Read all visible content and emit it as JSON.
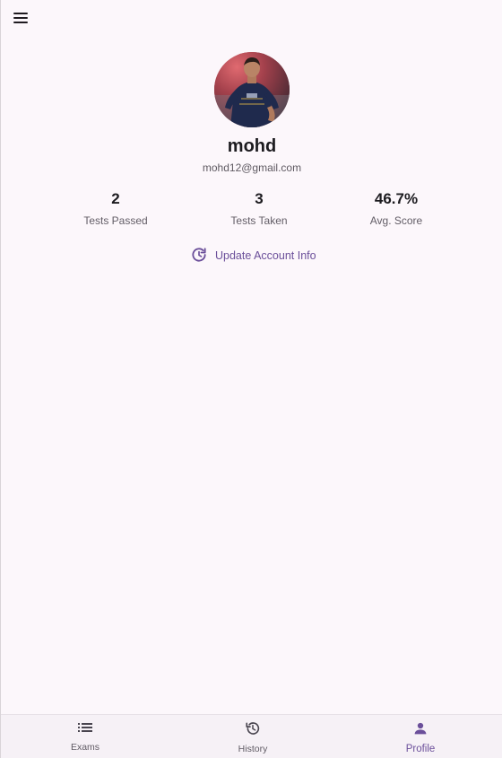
{
  "profile": {
    "name": "mohd",
    "email": "mohd12@gmail.com"
  },
  "stats": [
    {
      "value": "2",
      "label": "Tests Passed"
    },
    {
      "value": "3",
      "label": "Tests Taken"
    },
    {
      "value": "46.7%",
      "label": "Avg. Score"
    }
  ],
  "actions": {
    "update_label": "Update Account Info"
  },
  "nav": {
    "items": [
      {
        "label": "Exams",
        "icon": "list-icon"
      },
      {
        "label": "History",
        "icon": "history-icon"
      },
      {
        "label": "Profile",
        "icon": "person-icon"
      }
    ],
    "active": "Profile"
  },
  "colors": {
    "accent": "#6b4f9a",
    "background": "#fcf7fb"
  }
}
